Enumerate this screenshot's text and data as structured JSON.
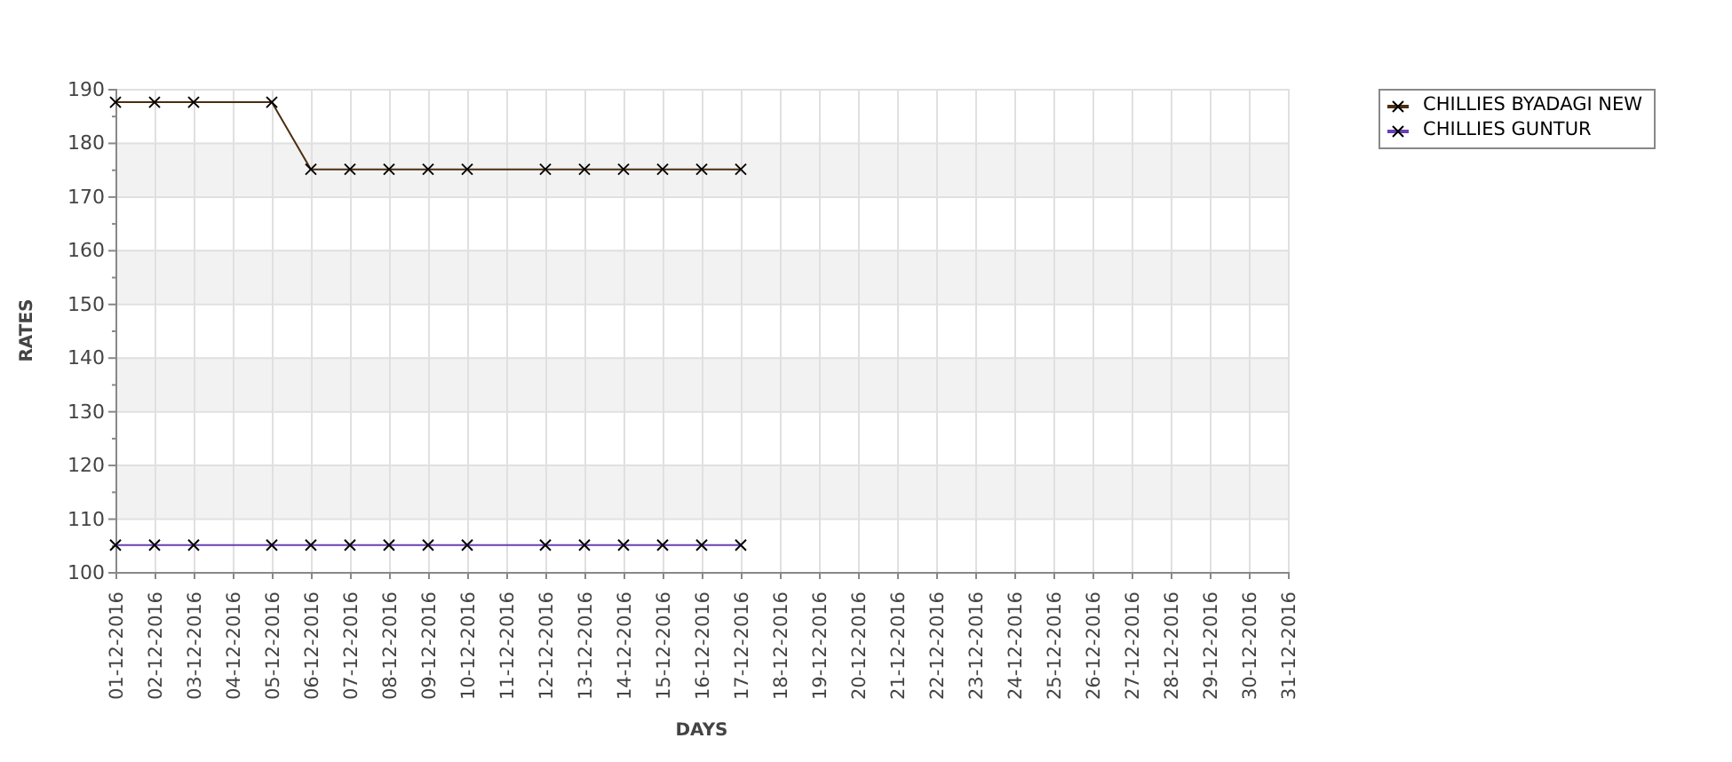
{
  "chart": {
    "chart_data": {
      "type": "line",
      "xlabel": "DAYS",
      "ylabel": "RATES",
      "categories": [
        "01-12-2016",
        "02-12-2016",
        "03-12-2016",
        "04-12-2016",
        "05-12-2016",
        "06-12-2016",
        "07-12-2016",
        "08-12-2016",
        "09-12-2016",
        "10-12-2016",
        "11-12-2016",
        "12-12-2016",
        "13-12-2016",
        "14-12-2016",
        "15-12-2016",
        "16-12-2016",
        "17-12-2016",
        "18-12-2016",
        "19-12-2016",
        "20-12-2016",
        "21-12-2016",
        "22-12-2016",
        "23-12-2016",
        "24-12-2016",
        "25-12-2016",
        "26-12-2016",
        "27-12-2016",
        "28-12-2016",
        "29-12-2016",
        "30-12-2016",
        "31-12-2016"
      ],
      "series": [
        {
          "name": "CHILLIES BYADAGI NEW",
          "color": "#4b2e0f",
          "marker": "x",
          "values": [
            187.5,
            187.5,
            187.5,
            null,
            187.5,
            175,
            175,
            175,
            175,
            175,
            null,
            175,
            175,
            175,
            175,
            175,
            175,
            null,
            null,
            null,
            null,
            null,
            null,
            null,
            null,
            null,
            null,
            null,
            null,
            null,
            null
          ]
        },
        {
          "name": "CHILLIES GUNTUR",
          "color": "#6a3fb5",
          "marker": "x",
          "values": [
            105,
            105,
            105,
            null,
            105,
            105,
            105,
            105,
            105,
            105,
            null,
            105,
            105,
            105,
            105,
            105,
            105,
            null,
            null,
            null,
            null,
            null,
            null,
            null,
            null,
            null,
            null,
            null,
            null,
            null,
            null
          ]
        }
      ],
      "grid": true,
      "ylim": [
        100,
        190
      ],
      "yticks": [
        100,
        110,
        120,
        130,
        140,
        150,
        160,
        170,
        180,
        190
      ]
    }
  }
}
